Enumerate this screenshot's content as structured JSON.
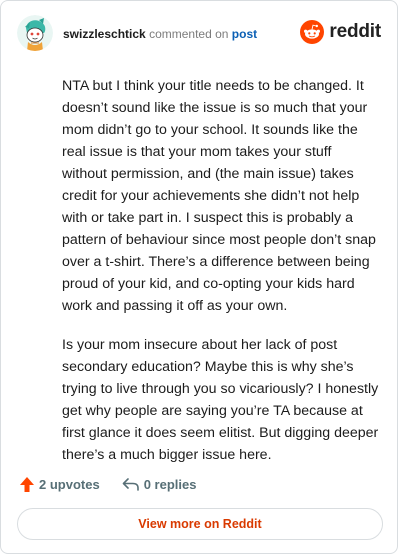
{
  "header": {
    "username": "swizzleschtick",
    "action_text": "commented on",
    "link_text": "post",
    "brand_name": "reddit",
    "avatar_icon": "snoo-avatar-icon",
    "brand_icon": "reddit-logo-icon"
  },
  "comment": {
    "paragraphs": [
      "NTA but I think your title needs to be changed. It doesn’t sound like the issue is so much that your mom didn’t go to your school. It sounds like the real issue is that your mom takes your stuff without permission, and (the main issue) takes credit for your achievements she didn’t not help with or take part in. I suspect this is probably a pattern of behaviour since most people don’t snap over a t-shirt. There’s a difference between being proud of your kid, and co-opting your kids hard work and passing it off as your own.",
      "Is your mom insecure about her lack of post secondary education? Maybe this is why she’s trying to live through you so vicariously? I honestly get why people are saying you’re TA because at first glance it does seem elitist. But digging deeper there’s a much bigger issue here."
    ]
  },
  "actions": {
    "upvotes_label": "2 upvotes",
    "replies_label": "0 replies",
    "upvote_icon": "upvote-arrow-icon",
    "reply_icon": "reply-arrow-icon"
  },
  "footer": {
    "button_label": "View more on Reddit"
  },
  "colors": {
    "brand_orange": "#ff4500",
    "link_blue": "#0a5fb4",
    "button_text": "#d93a00",
    "muted": "#576f76"
  }
}
